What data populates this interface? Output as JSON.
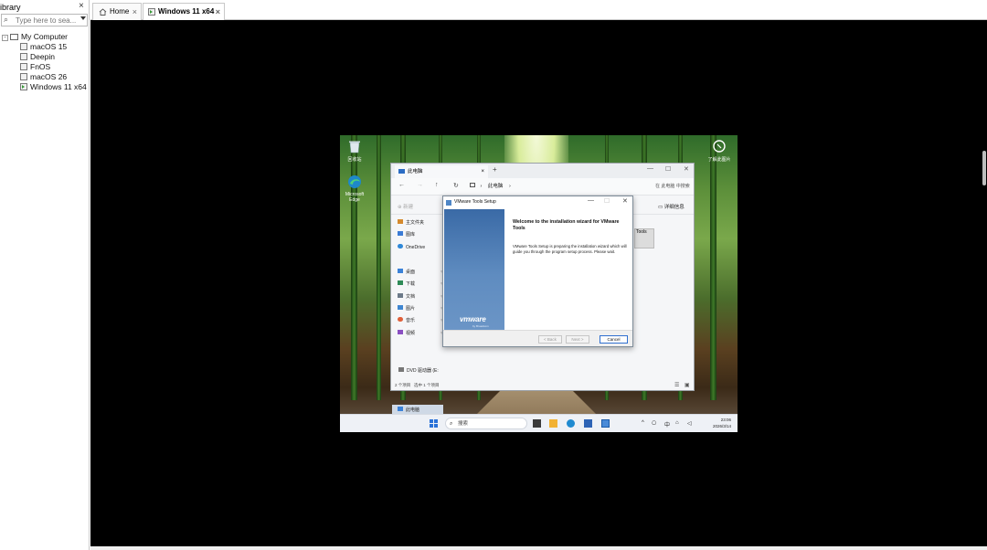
{
  "library": {
    "title": "ibrary",
    "close": "×",
    "search_placeholder": "Type here to sea...",
    "tree_root": "My Computer",
    "vms": [
      "macOS 15",
      "Deepin",
      "FnOS",
      "macOS 26",
      "Windows 11 x64"
    ]
  },
  "tabs": {
    "home": "Home",
    "vm": "Windows 11 x64",
    "close": "×"
  },
  "guest": {
    "desktop": {
      "recycle_bin": "回收站",
      "edge": "Microsoft Edge",
      "learn_more": "了解此图片"
    },
    "explorer": {
      "tab_title": "此电脑",
      "tab_close": "×",
      "new_tab": "+",
      "min": "—",
      "max": "☐",
      "close": "✕",
      "back": "←",
      "forward": "→",
      "up": "↑",
      "refresh": "↻",
      "path_sep": "›",
      "path": "此电脑",
      "path_end": "›",
      "search_placeholder": "在 此电脑 中搜索",
      "new_button": "新建",
      "details_button": "详细信息",
      "nav": [
        "主文件夹",
        "图库",
        "OneDrive",
        "桌面",
        "下载",
        "文档",
        "图片",
        "音乐",
        "视频",
        "此电脑",
        "DVD 驱动器 (E:"
      ],
      "tools_item": "Tools",
      "status_left": "2 个项目",
      "status_right": "选中 1 个项目"
    },
    "setup": {
      "title": "VMware Tools Setup",
      "min": "—",
      "max": "☐",
      "close": "✕",
      "heading": "Welcome to the installation wizard for VMware Tools",
      "body": "VMware Tools Setup is preparing the installation wizard which will guide you through the program setup process.  Please wait.",
      "logo": "vmware",
      "logo_sub": "by Broadcom",
      "back": "< Back",
      "next": "Next >",
      "cancel": "Cancel"
    },
    "taskbar": {
      "search": "搜索",
      "tray_up": "^",
      "ime": "中",
      "time": "23:06",
      "date": "2026/3/14"
    }
  },
  "colors": {
    "vm_background": "#000000",
    "setup_banner": "#3a6aa6",
    "accent": "#2f6fd0"
  }
}
